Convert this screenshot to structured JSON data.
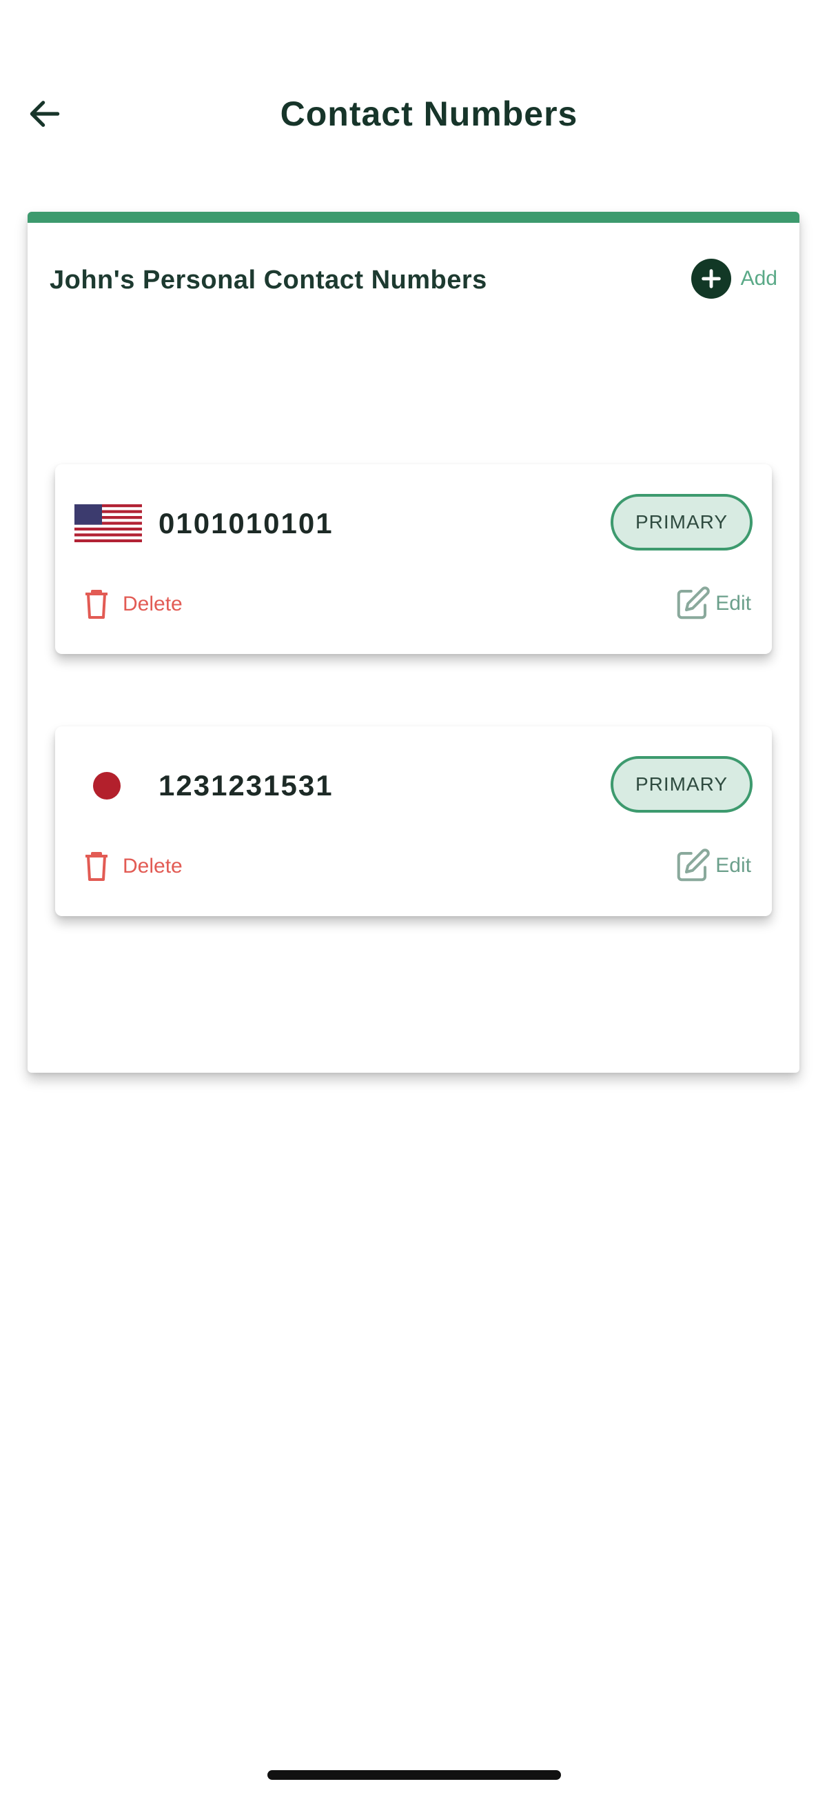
{
  "header": {
    "title": "Contact Numbers",
    "back_icon": "arrow-left-icon"
  },
  "card": {
    "heading": "John's Personal Contact Numbers",
    "add_label": "Add",
    "add_icon": "plus-circle-icon",
    "accent_color": "#3d9a6e"
  },
  "contacts": [
    {
      "flag_icon": "us-flag-icon",
      "number": "0101010101",
      "badge": "PRIMARY",
      "delete_label": "Delete",
      "edit_label": "Edit"
    },
    {
      "flag_icon": "jp-flag-icon",
      "number": "1231231531",
      "badge": "PRIMARY",
      "delete_label": "Delete",
      "edit_label": "Edit"
    }
  ],
  "colors": {
    "primary_green": "#3d9a6e",
    "dark_green": "#123826",
    "delete_red": "#e25b54",
    "badge_bg": "#d8ebe2"
  }
}
